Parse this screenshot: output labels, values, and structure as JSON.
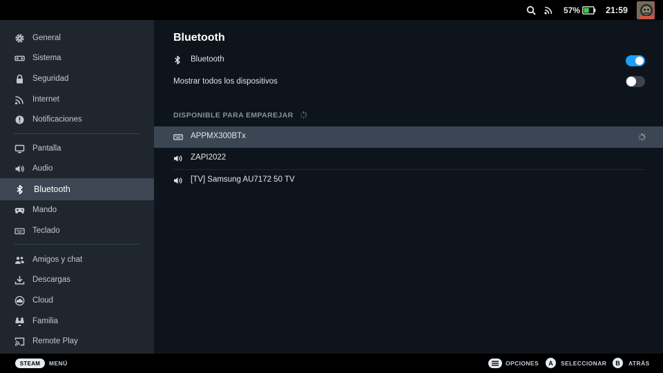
{
  "topbar": {
    "battery_pct": "57%",
    "battery_level": 0.57,
    "time": "21:59",
    "icons": [
      "search-icon",
      "wifi-icon",
      "battery-icon",
      "avatar"
    ]
  },
  "sidebar": {
    "items": [
      {
        "label": "General",
        "icon": "gear-icon"
      },
      {
        "label": "Sistema",
        "icon": "system-icon"
      },
      {
        "label": "Seguridad",
        "icon": "lock-icon"
      },
      {
        "label": "Internet",
        "icon": "wifi-icon"
      },
      {
        "label": "Notificaciones",
        "icon": "info-icon"
      },
      {
        "label": "Pantalla",
        "icon": "monitor-icon"
      },
      {
        "label": "Audio",
        "icon": "speaker-icon"
      },
      {
        "label": "Bluetooth",
        "icon": "bluetooth-icon",
        "active": true
      },
      {
        "label": "Mando",
        "icon": "gamepad-icon"
      },
      {
        "label": "Teclado",
        "icon": "keyboard-icon"
      },
      {
        "label": "Amigos y chat",
        "icon": "friends-icon"
      },
      {
        "label": "Descargas",
        "icon": "download-icon"
      },
      {
        "label": "Cloud",
        "icon": "cloud-icon"
      },
      {
        "label": "Familia",
        "icon": "family-icon"
      },
      {
        "label": "Remote Play",
        "icon": "cast-icon"
      }
    ]
  },
  "main": {
    "title": "Bluetooth",
    "bluetooth_label": "Bluetooth",
    "bluetooth_on": true,
    "show_all_label": "Mostrar todos los dispositivos",
    "show_all_on": false,
    "section_header": "DISPONIBLE PARA EMPAREJAR",
    "devices": [
      {
        "name": "APPMX300BTx",
        "icon": "keyboard-icon",
        "selected": true,
        "connecting": true
      },
      {
        "name": "ZAPI2022",
        "icon": "speaker-icon"
      },
      {
        "name": "[TV] Samsung AU7172 50 TV",
        "icon": "speaker-icon"
      }
    ]
  },
  "bottombar": {
    "steam_label": "STEAM",
    "menu_label": "MENÚ",
    "options_label": "OPCIONES",
    "a_key": "A",
    "select_label": "SELECCIONAR",
    "b_key": "B",
    "back_label": "ATRÁS"
  },
  "colors": {
    "accent": "#1a9fff",
    "sidebar_bg": "#1f262e",
    "main_bg": "#0e141b",
    "selected_row": "#3a4654"
  }
}
